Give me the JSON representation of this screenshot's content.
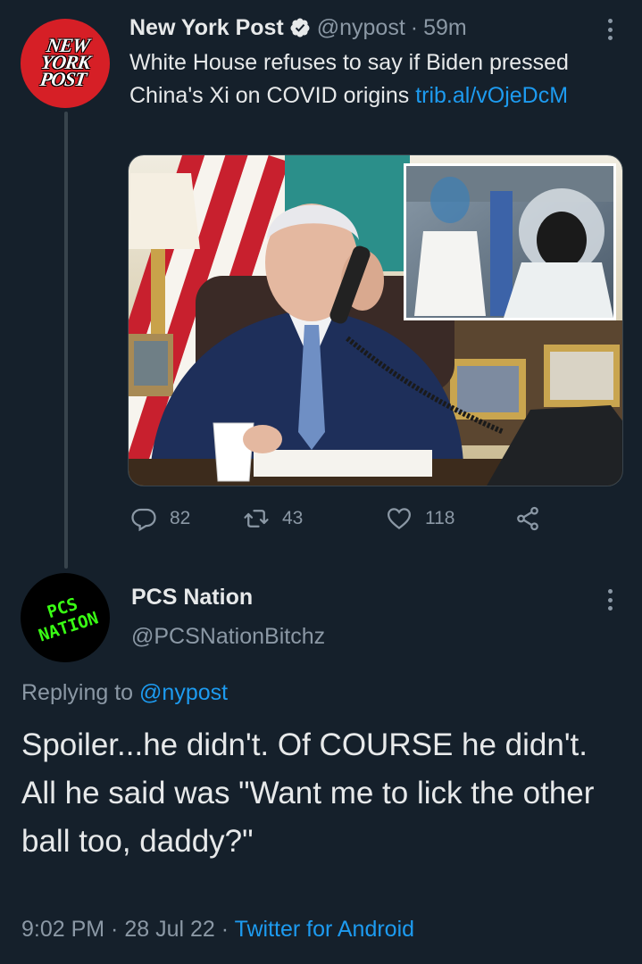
{
  "tweet": {
    "author_name": "New York Post",
    "avatar_text": "NEW YORK POST",
    "handle": "@nypost",
    "separator": "·",
    "time": "59m",
    "text": "White House refuses to say if Biden pressed China's Xi on COVID origins ",
    "link": "trib.al/vOjeDcM",
    "stats": {
      "replies": "82",
      "retweets": "43",
      "likes": "118"
    }
  },
  "reply": {
    "author_name": "PCS Nation",
    "avatar_text": "PCS NATION",
    "handle": "@PCSNationBitchz",
    "replying_prefix": "Replying to ",
    "replying_handle": "@nypost",
    "text_line1": "Spoiler...he didn't. Of COURSE he didn't.",
    "text_line2": "All he said was \"Want me to lick the other ball too, daddy?\"",
    "time": "9:02 PM",
    "sep1": " · ",
    "date": "28 Jul 22",
    "sep2": " · ",
    "client": "Twitter for Android"
  },
  "colors": {
    "background": "#15202b",
    "link": "#1d9bf0",
    "muted": "#8b98a5",
    "nyp_red": "#d61f26",
    "pcs_green": "#39ff14"
  },
  "icons": [
    "verified-badge-icon",
    "more-options-icon",
    "reply-icon",
    "retweet-icon",
    "like-icon",
    "share-icon"
  ]
}
